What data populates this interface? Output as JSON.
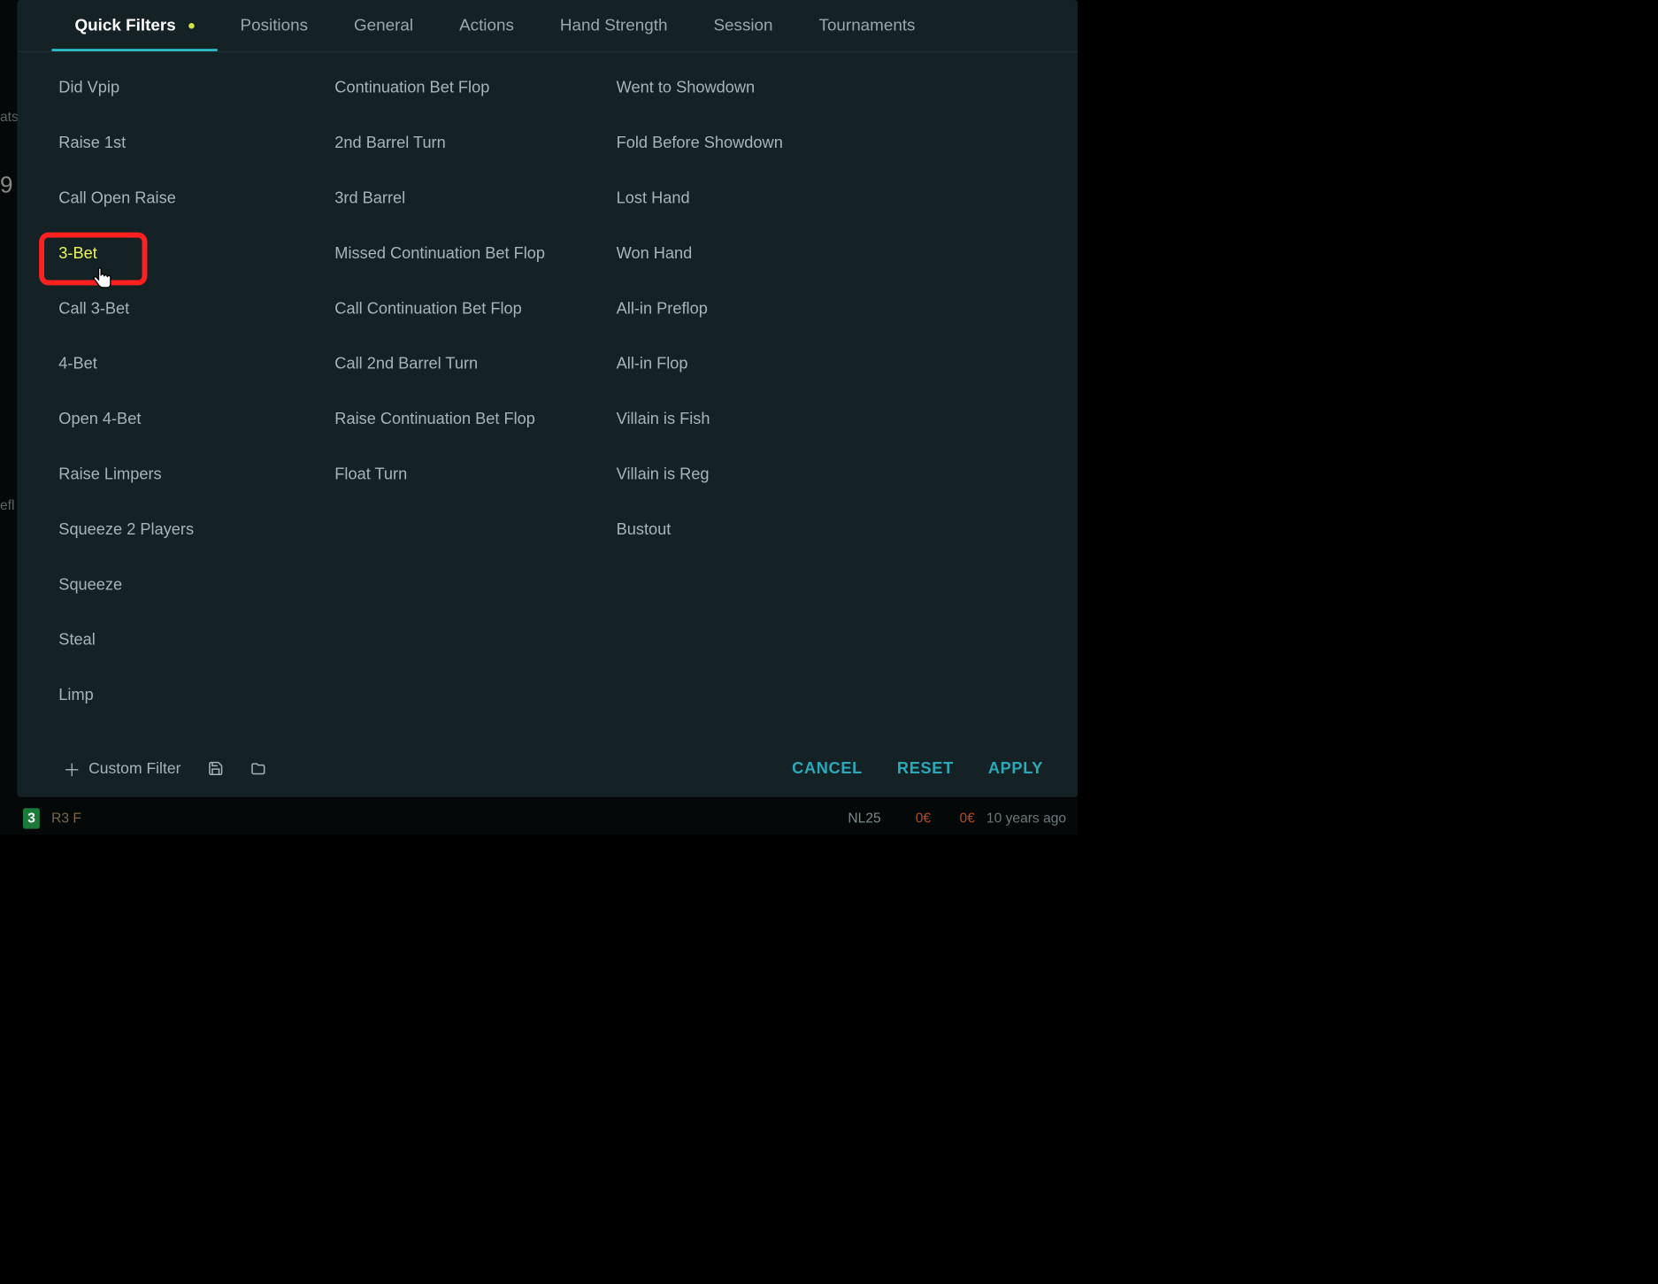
{
  "tabs": [
    {
      "label": "Quick Filters",
      "active": true,
      "has_dot": true
    },
    {
      "label": "Positions"
    },
    {
      "label": "General"
    },
    {
      "label": "Actions"
    },
    {
      "label": "Hand Strength"
    },
    {
      "label": "Session"
    },
    {
      "label": "Tournaments"
    }
  ],
  "columns": [
    {
      "items": [
        {
          "label": "Did Vpip"
        },
        {
          "label": "Raise 1st"
        },
        {
          "label": "Call Open Raise"
        },
        {
          "label": "3-Bet",
          "selected": true,
          "highlighted": true
        },
        {
          "label": "Call 3-Bet"
        },
        {
          "label": "4-Bet"
        },
        {
          "label": "Open 4-Bet"
        },
        {
          "label": "Raise Limpers"
        },
        {
          "label": "Squeeze 2 Players"
        },
        {
          "label": "Squeeze"
        },
        {
          "label": "Steal"
        },
        {
          "label": "Limp"
        }
      ]
    },
    {
      "items": [
        {
          "label": "Continuation Bet Flop"
        },
        {
          "label": "2nd Barrel Turn"
        },
        {
          "label": "3rd Barrel"
        },
        {
          "label": "Missed Continuation Bet Flop"
        },
        {
          "label": "Call Continuation Bet Flop"
        },
        {
          "label": "Call 2nd Barrel Turn"
        },
        {
          "label": "Raise Continuation Bet Flop"
        },
        {
          "label": "Float Turn"
        }
      ]
    },
    {
      "items": [
        {
          "label": "Went to Showdown"
        },
        {
          "label": "Fold Before Showdown"
        },
        {
          "label": "Lost Hand"
        },
        {
          "label": "Won Hand"
        },
        {
          "label": "All-in Preflop"
        },
        {
          "label": "All-in Flop"
        },
        {
          "label": "Villain is Fish"
        },
        {
          "label": "Villain is Reg"
        },
        {
          "label": "Bustout"
        }
      ]
    }
  ],
  "footer": {
    "custom_filter": "Custom Filter",
    "cancel": "CANCEL",
    "reset": "RESET",
    "apply": "APPLY"
  },
  "background": {
    "frag1": "ats",
    "frag2": "9",
    "frag3": "efl",
    "bottom_stake": "NL25",
    "bottom_amt1": "0€",
    "bottom_amt2": "0€",
    "bottom_age": "10 years ago",
    "bottom_left_code": "R3  F"
  }
}
